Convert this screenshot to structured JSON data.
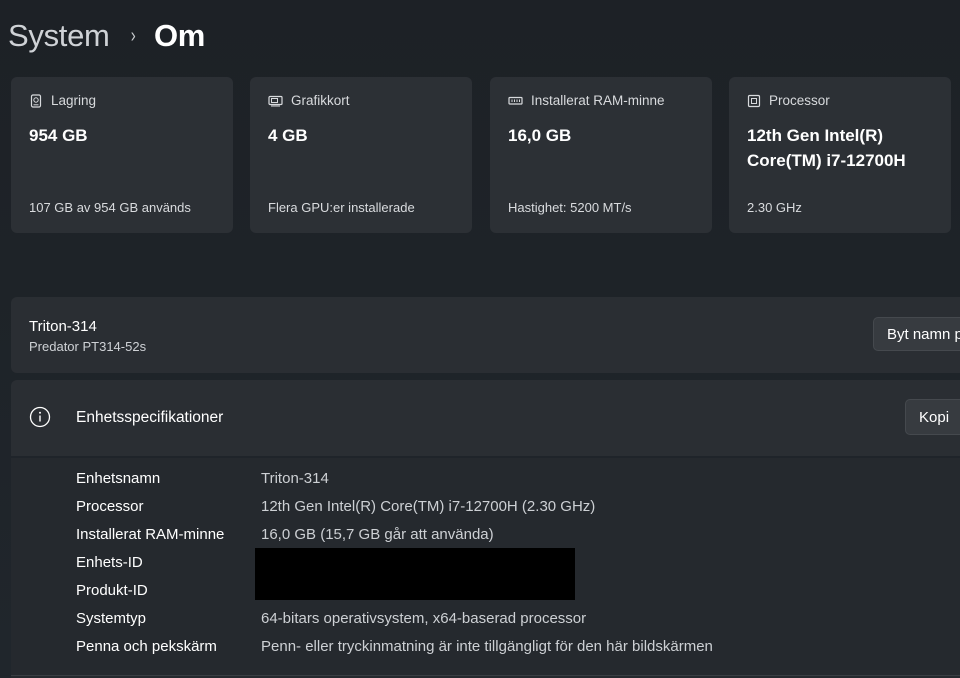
{
  "breadcrumb": {
    "parent": "System",
    "separator": "›",
    "current": "Om"
  },
  "tiles": [
    {
      "icon": "storage-icon",
      "label": "Lagring",
      "value": "954 GB",
      "sub": "107 GB av 954 GB används"
    },
    {
      "icon": "graphics-card-icon",
      "label": "Grafikkort",
      "value": "4 GB",
      "sub": "Flera GPU:er installerade"
    },
    {
      "icon": "ram-icon",
      "label": "Installerat RAM-minne",
      "value": "16,0 GB",
      "sub": "Hastighet: 5200 MT/s"
    },
    {
      "icon": "processor-icon",
      "label": "Processor",
      "value": "12th Gen Intel(R) Core(TM) i7-12700H",
      "sub": "2.30 GHz"
    }
  ],
  "device": {
    "name": "Triton-314",
    "model": "Predator PT314-52s",
    "rename_label": "Byt namn p"
  },
  "specs": {
    "title": "Enhetsspecifikationer",
    "copy_label": "Kopi",
    "rows": [
      {
        "label": "Enhetsnamn",
        "value": "Triton-314"
      },
      {
        "label": "Processor",
        "value": "12th Gen Intel(R) Core(TM) i7-12700H (2.30 GHz)"
      },
      {
        "label": "Installerat RAM-minne",
        "value": "16,0 GB (15,7 GB går att använda)"
      },
      {
        "label": "Enhets-ID",
        "value": ""
      },
      {
        "label": "Produkt-ID",
        "value": ""
      },
      {
        "label": "Systemtyp",
        "value": "64-bitars operativsystem, x64-baserad processor"
      },
      {
        "label": "Penna och pekskärm",
        "value": "Penn- eller tryckinmatning är inte tillgängligt för den här bildskärmen"
      }
    ]
  },
  "colors": {
    "background": "#1e2328",
    "card": "#2c3035",
    "text": "#ffffff",
    "secondary_text": "#cdd0d4",
    "redaction": "#000000"
  }
}
